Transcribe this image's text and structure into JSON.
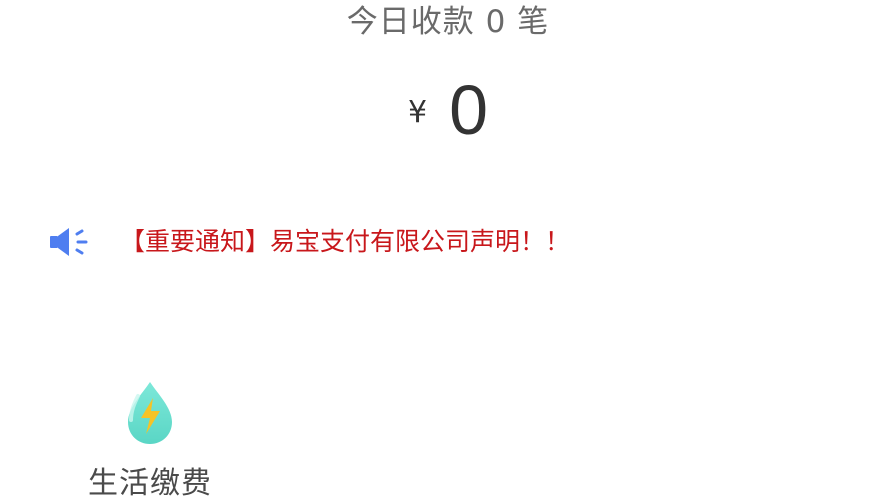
{
  "summary": {
    "today_count_text": "今日收款 0 笔",
    "currency_symbol": "¥",
    "amount": "0"
  },
  "notice": {
    "icon": "speaker-icon",
    "text": "【重要通知】易宝支付有限公司声明！！",
    "color": "#c8171b"
  },
  "services": [
    {
      "label": "生活缴费",
      "icon": "water-drop-lightning-icon"
    }
  ],
  "colors": {
    "accent_blue": "#4f7ef0",
    "drop_teal": "#6fe3d0",
    "bolt_yellow": "#f6c326"
  }
}
